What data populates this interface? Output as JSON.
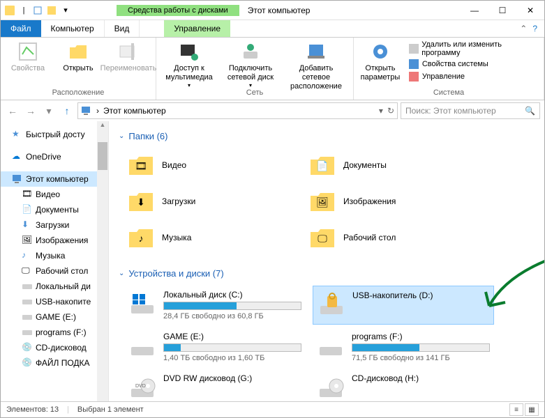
{
  "window": {
    "title": "Этот компьютер",
    "context_tab_title": "Средства работы с дисками",
    "context_tab_name": "Управление"
  },
  "tabs": {
    "file": "Файл",
    "computer": "Компьютер",
    "view": "Вид"
  },
  "ribbon": {
    "group_location": {
      "label": "Расположение",
      "props": "Свойства",
      "open": "Открыть",
      "rename": "Переименовать"
    },
    "group_network": {
      "label": "Сеть",
      "media": "Доступ к мультимедиа",
      "map_drive": "Подключить сетевой диск",
      "add_network": "Добавить сетевое расположение"
    },
    "group_system": {
      "label": "Система",
      "settings": "Открыть параметры",
      "uninstall": "Удалить или изменить программу",
      "sysprops": "Свойства системы",
      "manage": "Управление"
    }
  },
  "address": {
    "path": "Этот компьютер",
    "search_placeholder": "Поиск: Этот компьютер"
  },
  "nav": {
    "quick_access": "Быстрый досту",
    "onedrive": "OneDrive",
    "this_pc": "Этот компьютер",
    "videos": "Видео",
    "documents": "Документы",
    "downloads": "Загрузки",
    "pictures": "Изображения",
    "music": "Музыка",
    "desktop": "Рабочий стол",
    "local_disk": "Локальный ди",
    "usb": "USB-накопите",
    "game": "GAME (E:)",
    "programs": "programs (F:)",
    "cd": "CD-дисковод",
    "file_podka": "ФАЙЛ ПОДКА"
  },
  "groups": {
    "folders": {
      "header": "Папки (6)"
    },
    "drives": {
      "header": "Устройства и диски (7)"
    }
  },
  "folders": [
    {
      "name": "Видео"
    },
    {
      "name": "Документы"
    },
    {
      "name": "Загрузки"
    },
    {
      "name": "Изображения"
    },
    {
      "name": "Музыка"
    },
    {
      "name": "Рабочий стол"
    }
  ],
  "drives": [
    {
      "name": "Локальный диск (C:)",
      "sub": "28,4 ГБ свободно из 60,8 ГБ",
      "fill": 53
    },
    {
      "name": "USB-накопитель (D:)",
      "sub": "",
      "fill": null,
      "selected": true,
      "locked": true
    },
    {
      "name": "GAME (E:)",
      "sub": "1,40 ТБ свободно из 1,60 ТБ",
      "fill": 12
    },
    {
      "name": "programs (F:)",
      "sub": "71,5 ГБ свободно из 141 ГБ",
      "fill": 49
    },
    {
      "name": "DVD RW дисковод (G:)",
      "sub": "",
      "fill": null,
      "dvd": true
    },
    {
      "name": "CD-дисковод (H:)",
      "sub": "",
      "fill": null,
      "cd": true
    }
  ],
  "status": {
    "items": "Элементов: 13",
    "selected": "Выбран 1 элемент"
  }
}
